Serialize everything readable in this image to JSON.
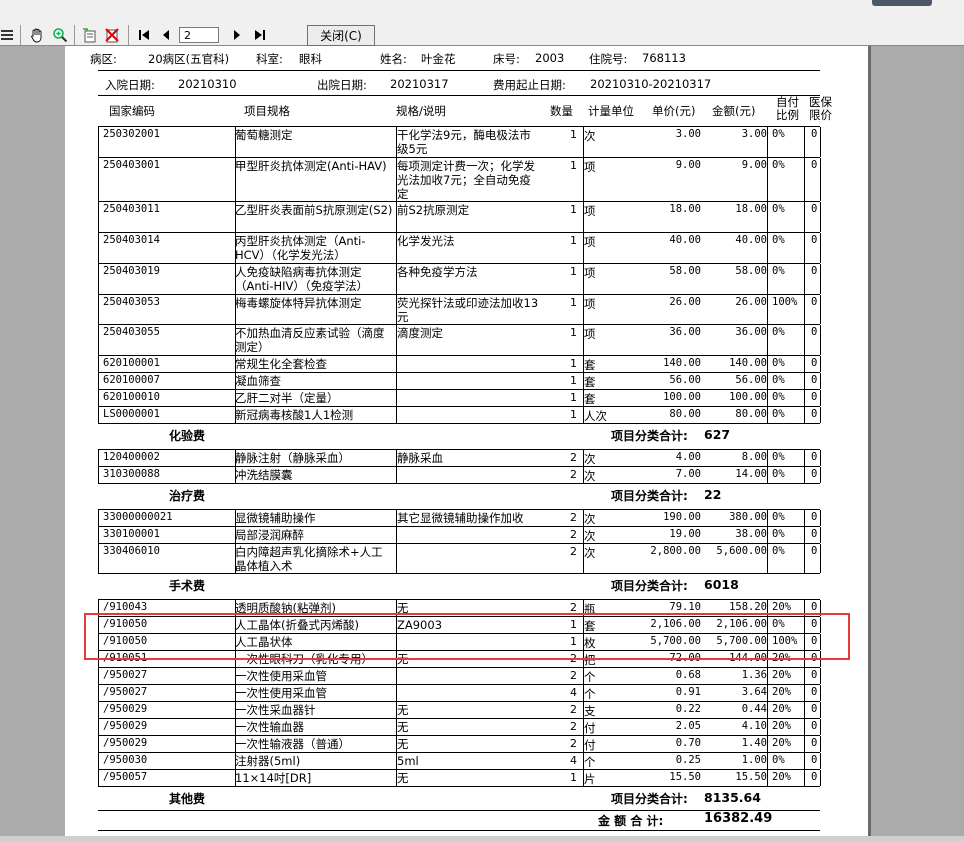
{
  "toolbar": {
    "page_value": "2",
    "close_label": "关闭(C)",
    "buttons": [
      "first-page",
      "prev-page",
      "next-page",
      "last-page"
    ]
  },
  "header": {
    "ward_label": "病区:",
    "ward_value": "20病区(五官科)",
    "dept_label": "科室:",
    "dept_value": "眼科",
    "name_label": "姓名:",
    "name_value": "叶金花",
    "bed_label": "床号:",
    "bed_value": "2003",
    "inpatient_label": "住院号:",
    "inpatient_value": "768113",
    "admit_label": "入院日期:",
    "admit_value": "20210310",
    "discharge_label": "出院日期:",
    "discharge_value": "20210317",
    "period_label": "费用起止日期:",
    "period_value": "20210310-20210317"
  },
  "columns": {
    "code": "国家编码",
    "item": "项目规格",
    "spec": "规格/说明",
    "qty": "数量",
    "unit": "计量单位",
    "price": "单价(元)",
    "amount": "金额(元)",
    "selfpay": "自付比例",
    "limit": "医保限价"
  },
  "groups": [
    {
      "rows": [
        {
          "code": "250302001",
          "item": "葡萄糖测定",
          "spec": "干化学法9元，酶电极法市级5元",
          "qty": "1",
          "unit": "次",
          "price": "3.00",
          "amount": "3.00",
          "pct": "0%",
          "lim": "0"
        },
        {
          "code": "250403001",
          "item": "甲型肝炎抗体测定(Anti-HAV)",
          "spec": "每项测定计费一次；化学发光法加收7元；全自动免疫定",
          "qty": "1",
          "unit": "项",
          "price": "9.00",
          "amount": "9.00",
          "pct": "0%",
          "lim": "0"
        },
        {
          "code": "250403011",
          "item": "乙型肝炎表面前S抗原测定(S2)",
          "spec": "前S2抗原测定",
          "qty": "1",
          "unit": "项",
          "price": "18.00",
          "amount": "18.00",
          "pct": "0%",
          "lim": "0"
        },
        {
          "code": "250403014",
          "item": "丙型肝炎抗体测定（Anti-HCV）（化学发光法）",
          "spec": "化学发光法",
          "qty": "1",
          "unit": "项",
          "price": "40.00",
          "amount": "40.00",
          "pct": "0%",
          "lim": "0"
        },
        {
          "code": "250403019",
          "item": "人免疫缺陷病毒抗体测定（Anti-HIV）（免疫学法）",
          "spec": "各种免疫学方法",
          "qty": "1",
          "unit": "项",
          "price": "58.00",
          "amount": "58.00",
          "pct": "0%",
          "lim": "0"
        },
        {
          "code": "250403053",
          "item": "梅毒螺旋体特异抗体测定",
          "spec": "荧光探针法或印迹法加收13元",
          "qty": "1",
          "unit": "项",
          "price": "26.00",
          "amount": "26.00",
          "pct": "100%",
          "lim": "0"
        },
        {
          "code": "250403055",
          "item": "不加热血清反应素试验（滴度测定）",
          "spec": "滴度测定",
          "qty": "1",
          "unit": "项",
          "price": "36.00",
          "amount": "36.00",
          "pct": "0%",
          "lim": "0"
        },
        {
          "code": "620100001",
          "item": "常规生化全套检查",
          "spec": "",
          "qty": "1",
          "unit": "套",
          "price": "140.00",
          "amount": "140.00",
          "pct": "0%",
          "lim": "0"
        },
        {
          "code": "620100007",
          "item": "凝血筛查",
          "spec": "",
          "qty": "1",
          "unit": "套",
          "price": "56.00",
          "amount": "56.00",
          "pct": "0%",
          "lim": "0"
        },
        {
          "code": "620100010",
          "item": "乙肝二对半（定量）",
          "spec": "",
          "qty": "1",
          "unit": "套",
          "price": "100.00",
          "amount": "100.00",
          "pct": "0%",
          "lim": "0"
        },
        {
          "code": "LS0000001",
          "item": "新冠病毒核酸1人1检测",
          "spec": "",
          "qty": "1",
          "unit": "人次",
          "price": "80.00",
          "amount": "80.00",
          "pct": "0%",
          "lim": "0"
        }
      ],
      "category": "化验费",
      "subtotal_label": "项目分类合计:",
      "subtotal": "627"
    },
    {
      "rows": [
        {
          "code": "120400002",
          "item": "静脉注射（静脉采血）",
          "spec": "静脉采血",
          "qty": "2",
          "unit": "次",
          "price": "4.00",
          "amount": "8.00",
          "pct": "0%",
          "lim": "0"
        },
        {
          "code": "310300088",
          "item": "冲洗结膜囊",
          "spec": "",
          "qty": "2",
          "unit": "次",
          "price": "7.00",
          "amount": "14.00",
          "pct": "0%",
          "lim": "0"
        }
      ],
      "category": "治疗费",
      "subtotal_label": "项目分类合计:",
      "subtotal": "22"
    },
    {
      "rows": [
        {
          "code": "33000000021",
          "item": "显微镜辅助操作",
          "spec": "其它显微镜辅助操作加收",
          "qty": "2",
          "unit": "次",
          "price": "190.00",
          "amount": "380.00",
          "pct": "0%",
          "lim": "0"
        },
        {
          "code": "330100001",
          "item": "局部浸润麻醉",
          "spec": "",
          "qty": "2",
          "unit": "次",
          "price": "19.00",
          "amount": "38.00",
          "pct": "0%",
          "lim": "0"
        },
        {
          "code": "330406010",
          "item": "白内障超声乳化摘除术+人工晶体植入术",
          "spec": "",
          "qty": "2",
          "unit": "次",
          "price": "2,800.00",
          "amount": "5,600.00",
          "pct": "0%",
          "lim": "0"
        }
      ],
      "category": "手术费",
      "subtotal_label": "项目分类合计:",
      "subtotal": "6018"
    },
    {
      "rows": [
        {
          "code": "/910043",
          "item": "透明质酸钠(粘弹剂)",
          "spec": "无",
          "qty": "2",
          "unit": "瓶",
          "price": "79.10",
          "amount": "158.20",
          "pct": "20%",
          "lim": "0"
        },
        {
          "code": "/910050",
          "item": "人工晶体(折叠式丙烯酸)",
          "spec": "ZA9003",
          "qty": "1",
          "unit": "套",
          "price": "2,106.00",
          "amount": "2,106.00",
          "pct": "0%",
          "lim": "0"
        },
        {
          "code": "/910050",
          "item": "人工晶状体",
          "spec": "",
          "qty": "1",
          "unit": "枚",
          "price": "5,700.00",
          "amount": "5,700.00",
          "pct": "100%",
          "lim": "0"
        },
        {
          "code": "/910051",
          "item": "一次性眼科刀（乳化专用）",
          "spec": "无",
          "qty": "2",
          "unit": "把",
          "price": "72.00",
          "amount": "144.00",
          "pct": "20%",
          "lim": "0"
        },
        {
          "code": "/950027",
          "item": "一次性使用采血管",
          "spec": "",
          "qty": "2",
          "unit": "个",
          "price": "0.68",
          "amount": "1.36",
          "pct": "20%",
          "lim": "0"
        },
        {
          "code": "/950027",
          "item": "一次性使用采血管",
          "spec": "",
          "qty": "4",
          "unit": "个",
          "price": "0.91",
          "amount": "3.64",
          "pct": "20%",
          "lim": "0"
        },
        {
          "code": "/950029",
          "item": "一次性采血器针",
          "spec": "无",
          "qty": "2",
          "unit": "支",
          "price": "0.22",
          "amount": "0.44",
          "pct": "20%",
          "lim": "0"
        },
        {
          "code": "/950029",
          "item": "一次性输血器",
          "spec": "无",
          "qty": "2",
          "unit": "付",
          "price": "2.05",
          "amount": "4.10",
          "pct": "20%",
          "lim": "0"
        },
        {
          "code": "/950029",
          "item": "一次性输液器（普通）",
          "spec": "无",
          "qty": "2",
          "unit": "付",
          "price": "0.70",
          "amount": "1.40",
          "pct": "20%",
          "lim": "0"
        },
        {
          "code": "/950030",
          "item": "注射器(5ml)",
          "spec": "5ml",
          "qty": "4",
          "unit": "个",
          "price": "0.25",
          "amount": "1.00",
          "pct": "0%",
          "lim": "0"
        },
        {
          "code": "/950057",
          "item": "11×14吋[DR]",
          "spec": "无",
          "qty": "1",
          "unit": "片",
          "price": "15.50",
          "amount": "15.50",
          "pct": "20%",
          "lim": "0"
        }
      ],
      "category": "其他费",
      "subtotal_label": "项目分类合计:",
      "subtotal": "8135.64"
    }
  ],
  "total": {
    "label": "金 额 合 计:",
    "value": "16382.49"
  },
  "colors": {
    "highlight": "#e23b3b",
    "toolbar": "#f0f0f0",
    "background": "#ababab"
  }
}
